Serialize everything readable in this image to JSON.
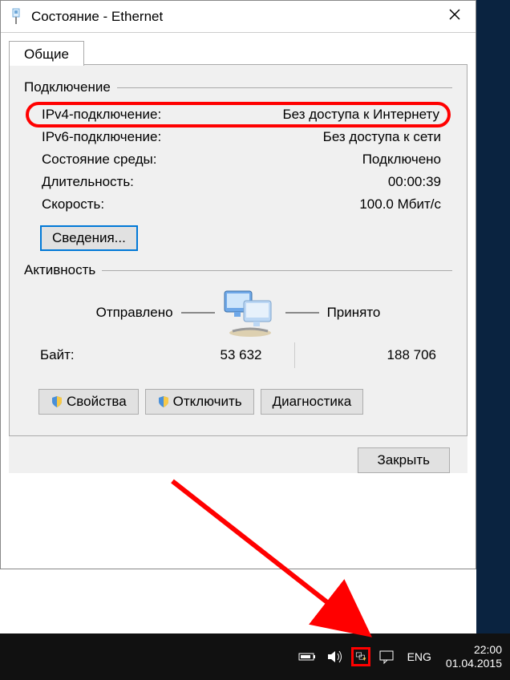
{
  "window": {
    "title": "Состояние - Ethernet"
  },
  "tabs": {
    "general": "Общие"
  },
  "connection": {
    "group_title": "Подключение",
    "ipv4_label": "IPv4-подключение:",
    "ipv4_value": "Без доступа к Интернету",
    "ipv6_label": "IPv6-подключение:",
    "ipv6_value": "Без доступа к сети",
    "media_label": "Состояние среды:",
    "media_value": "Подключено",
    "duration_label": "Длительность:",
    "duration_value": "00:00:39",
    "speed_label": "Скорость:",
    "speed_value": "100.0 Мбит/с",
    "details_btn": "Сведения..."
  },
  "activity": {
    "group_title": "Активность",
    "sent_label": "Отправлено",
    "recv_label": "Принято",
    "bytes_label": "Байт:",
    "bytes_sent": "53 632",
    "bytes_recv": "188 706"
  },
  "actions": {
    "properties": "Свойства",
    "disable": "Отключить",
    "diagnose": "Диагностика",
    "close": "Закрыть"
  },
  "taskbar": {
    "lang": "ENG",
    "time": "22:00",
    "date": "01.04.2015"
  },
  "icons": {
    "ethernet": "ethernet-icon",
    "shield": "shield-icon",
    "battery": "battery-icon",
    "volume": "volume-icon",
    "network": "network-warning-icon",
    "actioncenter": "action-center-icon"
  }
}
